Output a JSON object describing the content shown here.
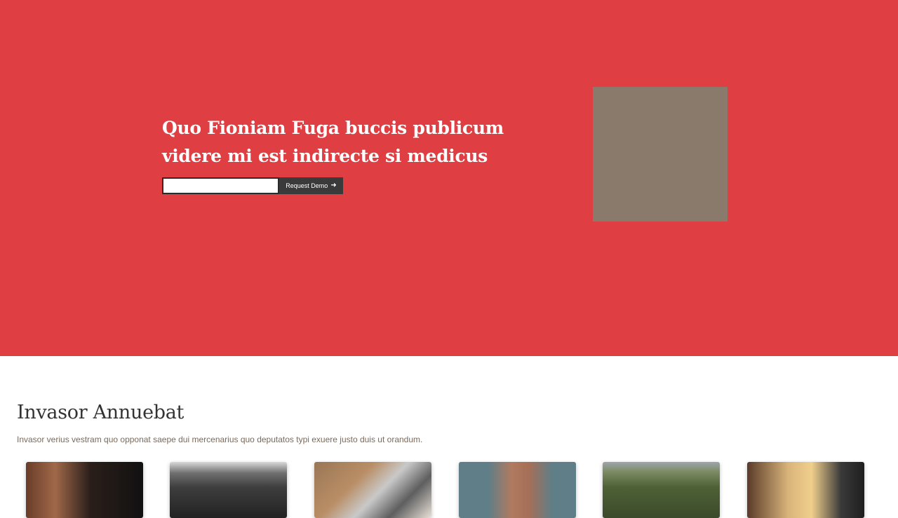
{
  "hero": {
    "headline": "Quo Fioniam Fuga buccis publicum videre mi est indirecte si medicus",
    "input": {
      "value": "",
      "placeholder": ""
    },
    "button_label": "Request Demo",
    "button_icon": "arrow-right-icon",
    "background_color": "#df3e42",
    "image_color": "#8a7a6c"
  },
  "section": {
    "title": "Invasor Annuebat",
    "description": "Invasor verius vestram quo opponat saepe dui mercenarius quo deputatos typi exuere justo duis ut orandum."
  },
  "cards": [
    {
      "name": "portrait-woman"
    },
    {
      "name": "ocean-waves"
    },
    {
      "name": "laptop-typing"
    },
    {
      "name": "portrait-man"
    },
    {
      "name": "green-hills-landscape"
    },
    {
      "name": "woman-portrait-warm"
    }
  ]
}
